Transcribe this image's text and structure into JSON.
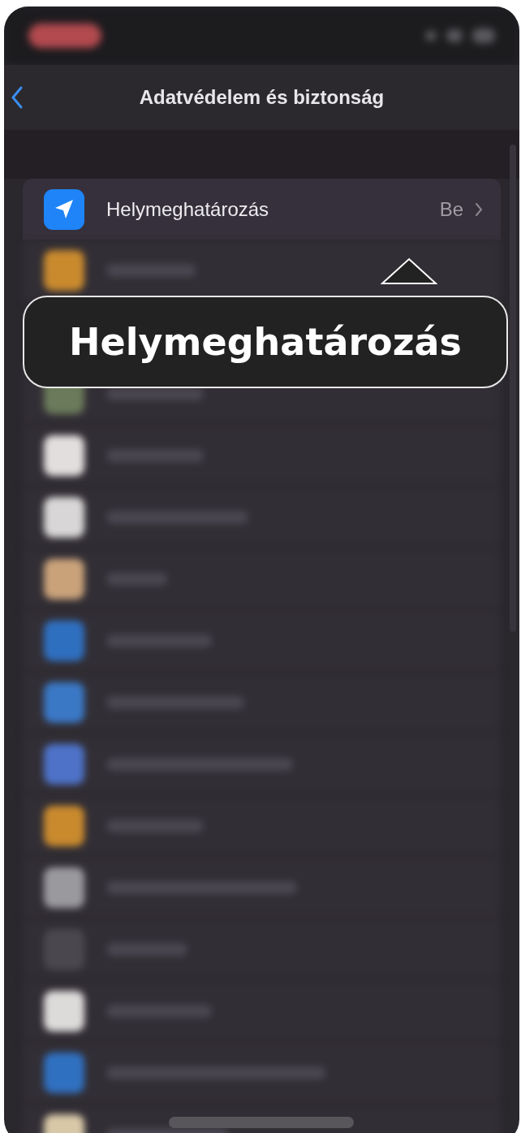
{
  "nav": {
    "title": "Adatvédelem és biztonság"
  },
  "rows": [
    {
      "label": "Helymeghatározás",
      "value": "Be"
    }
  ],
  "blurred_rows": [
    {
      "color": "#c98a2e"
    },
    {
      "color": "#6a7a5a"
    },
    {
      "color": "#e2dede"
    },
    {
      "color": "#d8d6d6"
    },
    {
      "color": "#c9a27a"
    },
    {
      "color": "#2f6fc0"
    },
    {
      "color": "#3a78c6"
    },
    {
      "color": "#4d72c8"
    },
    {
      "color": "#c98a2e"
    },
    {
      "color": "#9a999e"
    },
    {
      "color": "#4a484e"
    },
    {
      "color": "#dddada"
    },
    {
      "color": "#3070c0"
    },
    {
      "color": "#d8c8a8"
    }
  ],
  "callout": {
    "text": "Helymeghatározás"
  }
}
